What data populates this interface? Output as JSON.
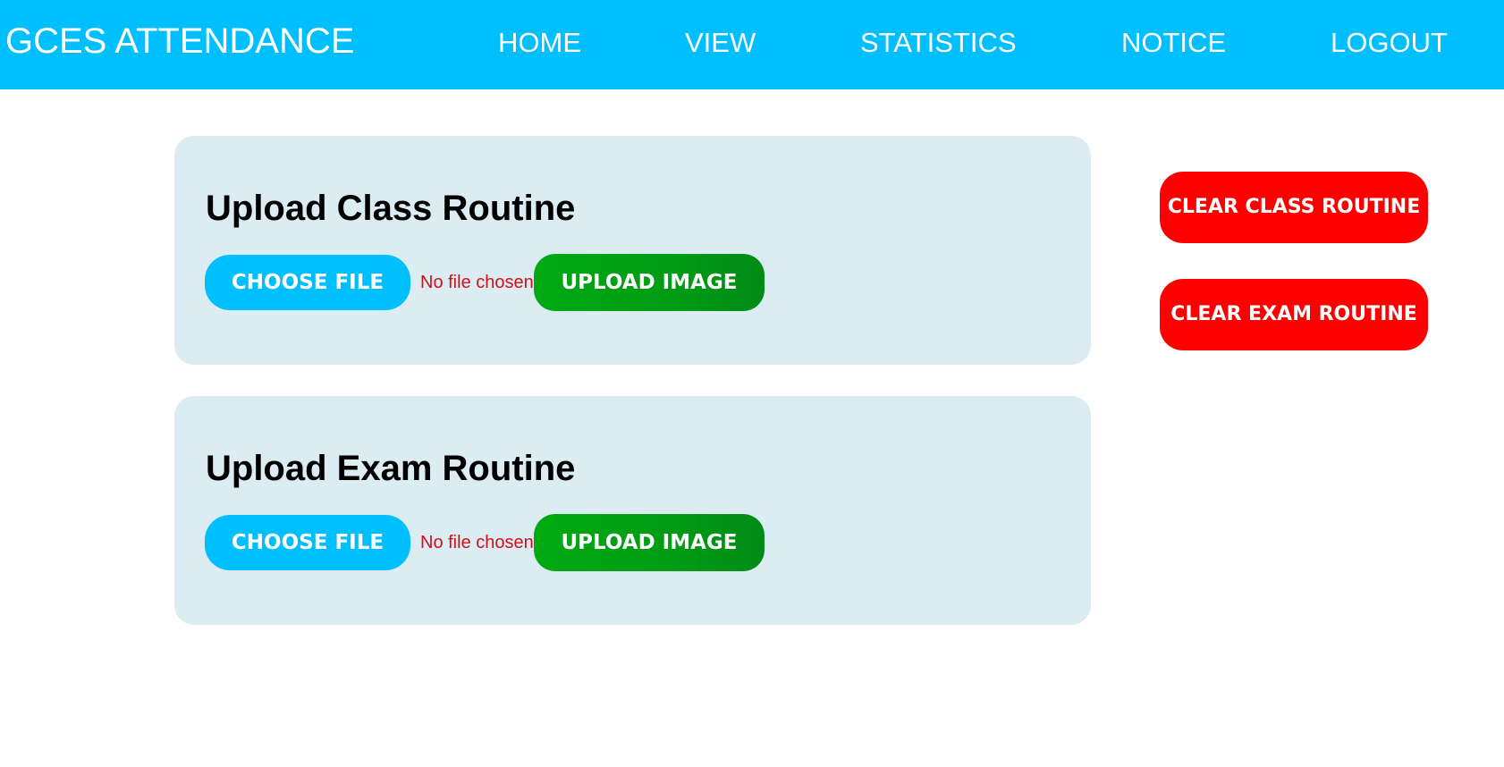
{
  "header": {
    "brand": "GCES ATTENDANCE",
    "nav": [
      {
        "label": "HOME"
      },
      {
        "label": "VIEW"
      },
      {
        "label": "STATISTICS"
      },
      {
        "label": "NOTICE"
      },
      {
        "label": "LOGOUT"
      }
    ]
  },
  "main": {
    "class_routine": {
      "title": "Upload Class Routine",
      "choose_label": "CHOOSE FILE",
      "file_status": "No file chosen",
      "upload_label": "UPLOAD IMAGE"
    },
    "exam_routine": {
      "title": "Upload Exam Routine",
      "choose_label": "CHOOSE FILE",
      "file_status": "No file chosen",
      "upload_label": "UPLOAD IMAGE"
    }
  },
  "actions": {
    "clear_class": "CLEAR CLASS ROUTINE",
    "clear_exam": "CLEAR EXAM ROUTINE"
  },
  "colors": {
    "header_bg": "#00bfff",
    "card_bg": "#dbecf3",
    "choose_btn": "#00bfff",
    "upload_btn": "#00a012",
    "clear_btn": "#ff0000",
    "status_text": "#d0101c"
  }
}
